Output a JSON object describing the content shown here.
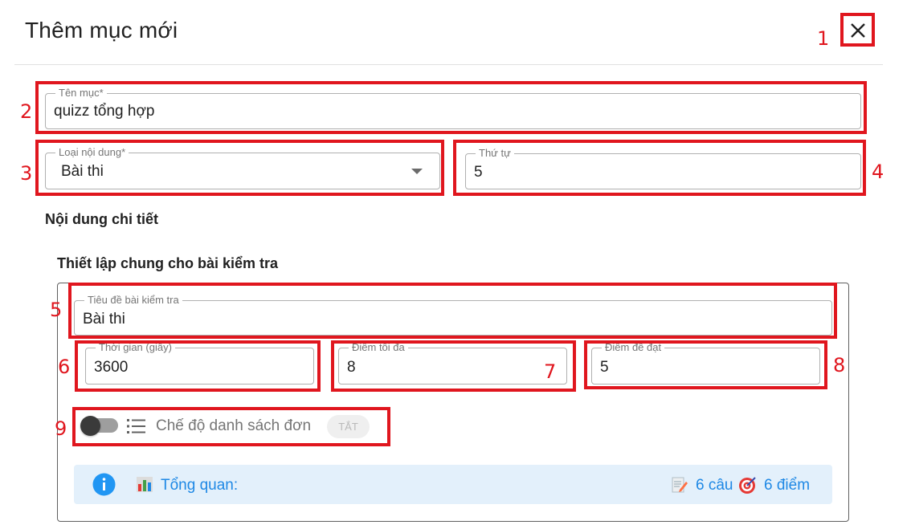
{
  "dialog": {
    "title": "Thêm mục mới",
    "close_icon": "close-icon"
  },
  "fields": {
    "item_name": {
      "label": "Tên mục*",
      "value": "quizz tổng hợp"
    },
    "content_type": {
      "label": "Loại nội dung*",
      "value": "Bài thi"
    },
    "order": {
      "label": "Thứ tự",
      "value": "5"
    }
  },
  "sections": {
    "detail_title": "Nội dung chi tiết",
    "quiz_settings_title": "Thiết lập chung cho bài kiểm tra"
  },
  "quiz": {
    "title_field": {
      "label": "Tiêu đề bài kiểm tra",
      "value": "Bài thi"
    },
    "time_field": {
      "label": "Thời gian (giây)",
      "value": "3600"
    },
    "max_score_field": {
      "label": "Điểm tối đa",
      "value": "8"
    },
    "pass_score_field": {
      "label": "Điểm đề đạt",
      "value": "5"
    },
    "single_list_mode": {
      "label": "Chế độ danh sách đơn",
      "state": "TẮT",
      "enabled": false
    }
  },
  "summary": {
    "label": "Tổng quan:",
    "questions": "6 câu",
    "points": "6 điểm"
  },
  "annotations": [
    "1",
    "2",
    "3",
    "4",
    "5",
    "6",
    "7",
    "8",
    "9"
  ],
  "colors": {
    "annotation_red": "#e0161e",
    "summary_bg": "#e3f0fb",
    "info_blue": "#2196f3",
    "summary_text_blue": "#1e88e5"
  }
}
